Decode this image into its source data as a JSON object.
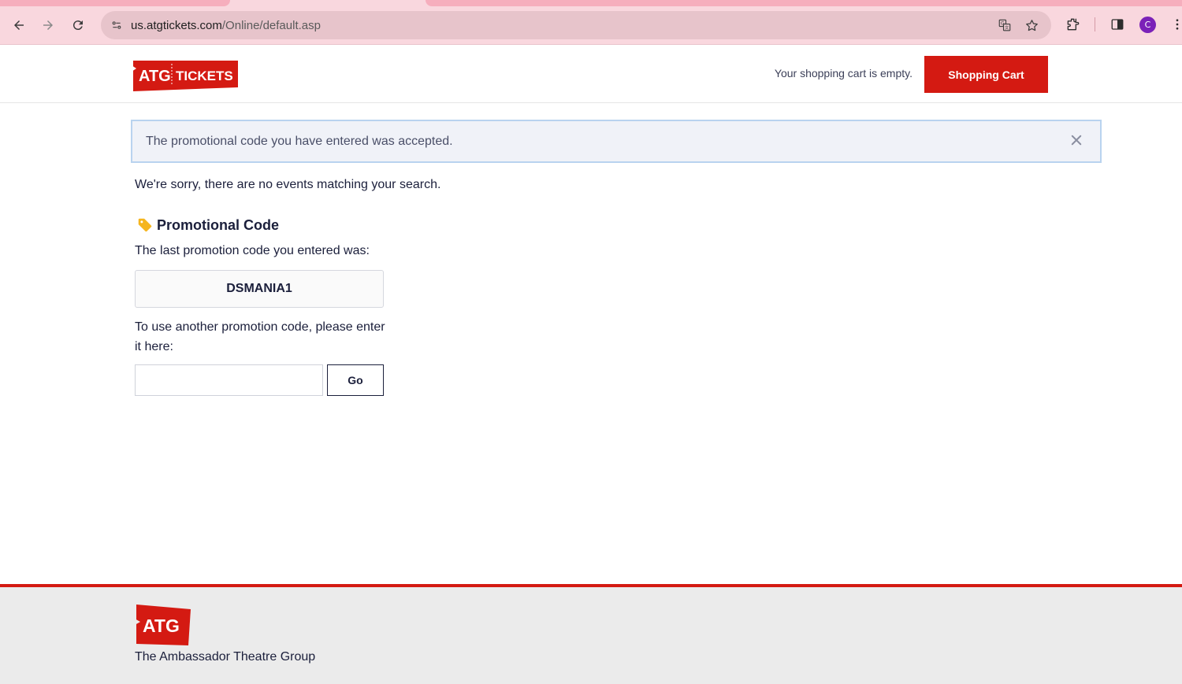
{
  "browser": {
    "url_host": "us.atgtickets.com",
    "url_path": "/Online/default.asp",
    "profile_initial": "C",
    "accent_color": "#f9d7de"
  },
  "header": {
    "logo_text_left": "ATG",
    "logo_text_right": "TICKETS",
    "cart_status": "Your shopping cart is empty.",
    "cart_button_label": "Shopping Cart",
    "brand_color": "#d41a12"
  },
  "alert": {
    "message": "The promotional code you have entered was accepted."
  },
  "main": {
    "no_events_message": "We're sorry, there are no events matching your search.",
    "promo_heading": "Promotional Code",
    "last_code_label": "The last promotion code you entered was:",
    "last_code_value": "DSMANIA1",
    "another_code_label": "To use another promotion code, please enter it here:",
    "promo_input_value": "",
    "go_button_label": "Go"
  },
  "footer": {
    "logo_text": "ATG",
    "org_name": "The Ambassador Theatre Group"
  },
  "icons": [
    "back-icon",
    "forward-icon",
    "reload-icon",
    "site-info-icon",
    "translate-icon",
    "bookmark-star-icon",
    "extensions-icon",
    "side-panel-icon",
    "close-icon",
    "tag-icon"
  ]
}
